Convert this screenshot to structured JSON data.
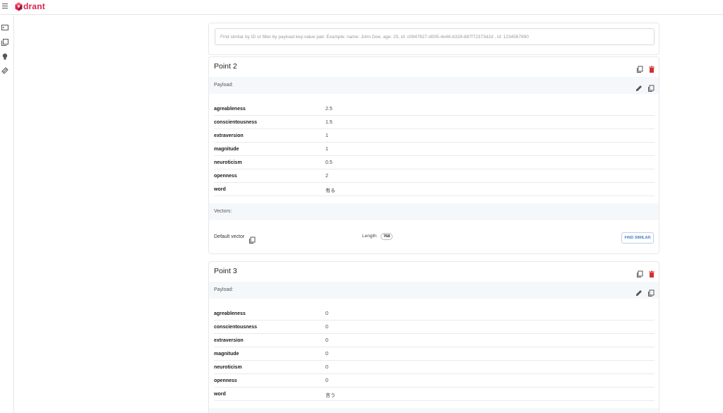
{
  "app": {
    "logo_text": "drant",
    "brand_color": "#dc244c"
  },
  "sidebar": {
    "items": [
      {
        "icon": "console-icon"
      },
      {
        "icon": "collections-icon"
      },
      {
        "icon": "tutorial-bulb-icon"
      },
      {
        "icon": "datasets-icon"
      }
    ]
  },
  "search": {
    "placeholder": "Find similar by ID or filter by payload key:value pair. Example: name: John Doe, age: 25, id: c0847827-d005-4e46-b328-887f72373d2d , id: 1234567890"
  },
  "points": [
    {
      "title": "Point 2",
      "payload_label": "Payload:",
      "payload": [
        {
          "key": "agreableness",
          "value": "2.5"
        },
        {
          "key": "conscientousness",
          "value": "1.5"
        },
        {
          "key": "extraversion",
          "value": "1"
        },
        {
          "key": "magnitude",
          "value": "1"
        },
        {
          "key": "neuroticism",
          "value": "0.5"
        },
        {
          "key": "openness",
          "value": "2"
        },
        {
          "key": "word",
          "value": "有る"
        }
      ],
      "vectors_label": "Vectors:",
      "vector_name": "Default vector",
      "length_label": "Length:",
      "length_value": "768",
      "find_similar_label": "FIND SIMILAR"
    },
    {
      "title": "Point 3",
      "payload_label": "Payload:",
      "payload": [
        {
          "key": "agreableness",
          "value": "0"
        },
        {
          "key": "conscientousness",
          "value": "0"
        },
        {
          "key": "extraversion",
          "value": "0"
        },
        {
          "key": "magnitude",
          "value": "0"
        },
        {
          "key": "neuroticism",
          "value": "0"
        },
        {
          "key": "openness",
          "value": "0"
        },
        {
          "key": "word",
          "value": "言う"
        }
      ]
    }
  ],
  "colors": {
    "delete": "#d32f2f",
    "section_bg": "#f5f8fa",
    "accent_blue": "#4a80c2"
  }
}
